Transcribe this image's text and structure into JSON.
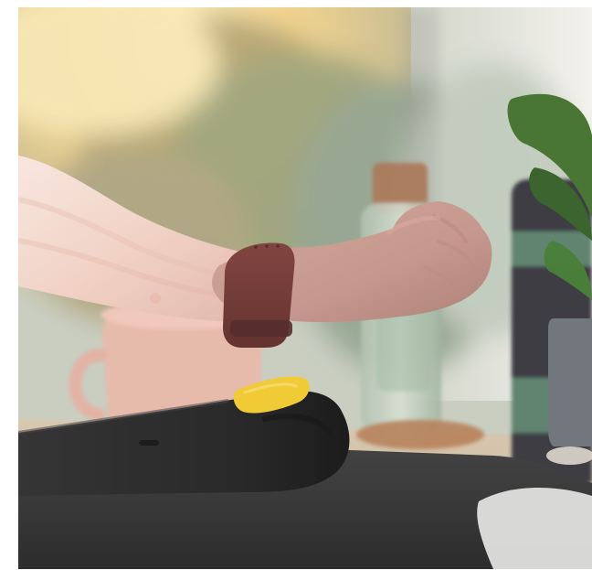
{
  "image": {
    "alt": "",
    "scene": {
      "background_colors": [
        "#f3e1a2",
        "#c9b27d",
        "#bfc8b6",
        "#e8e6e0"
      ],
      "desk_color": "#d7c8b1",
      "mat_color": "#2e2f31",
      "terminal_color": "#1c1c1e",
      "terminal_accent": "#f0c92c",
      "watch_band_color": "#6a2f2c",
      "sleeve_color": "#f1d3c7",
      "skin_color": "#c99b8c",
      "mug_color": "#e7b8aa",
      "plant_color": "#3f6f2b"
    }
  }
}
